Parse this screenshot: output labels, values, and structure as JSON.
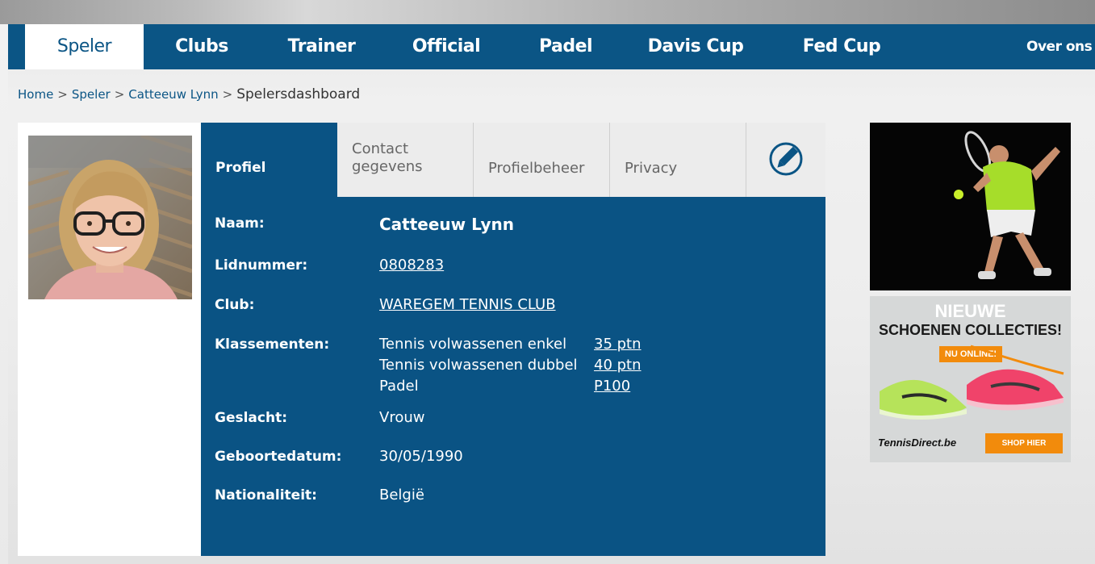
{
  "nav": {
    "items": [
      {
        "label": "Speler",
        "active": true
      },
      {
        "label": "Clubs"
      },
      {
        "label": "Trainer"
      },
      {
        "label": "Official"
      },
      {
        "label": "Padel"
      },
      {
        "label": "Davis Cup"
      },
      {
        "label": "Fed Cup"
      },
      {
        "label": "Over ons"
      }
    ]
  },
  "breadcrumb": {
    "items": [
      "Home",
      "Speler",
      "Catteeuw Lynn"
    ],
    "separator": ">",
    "current": "Spelersdashboard"
  },
  "tabs": {
    "profiel": "Profiel",
    "contact_line1": "Contact",
    "contact_line2": "gegevens",
    "profielbeheer": "Profielbeheer",
    "privacy": "Privacy",
    "edit_icon": "pencil-icon"
  },
  "profile": {
    "naam_label": "Naam:",
    "naam": "Catteeuw Lynn",
    "lidnummer_label": "Lidnummer:",
    "lidnummer": "0808283",
    "club_label": "Club:",
    "club": "WAREGEM TENNIS CLUB",
    "klassementen_label": "Klassementen:",
    "klassementen": [
      {
        "name": "Tennis volwassenen enkel",
        "value": "35 ptn"
      },
      {
        "name": "Tennis volwassenen dubbel",
        "value": "40 ptn"
      },
      {
        "name": "Padel",
        "value": "P100"
      }
    ],
    "geslacht_label": "Geslacht:",
    "geslacht": "Vrouw",
    "geboortedatum_label": "Geboortedatum:",
    "geboortedatum": "30/05/1990",
    "nationaliteit_label": "Nationaliteit:",
    "nationaliteit": "België"
  },
  "ads": {
    "ad2": {
      "line1": "NIEUWE",
      "line2": "SCHOENEN COLLECTIES!",
      "badge": "NU ONLINE!",
      "brand": "TennisDirect.be",
      "cta": "SHOP HIER"
    }
  },
  "colors": {
    "primary": "#0b5585",
    "card": "#0a5384",
    "accent_orange": "#f28b0c"
  }
}
